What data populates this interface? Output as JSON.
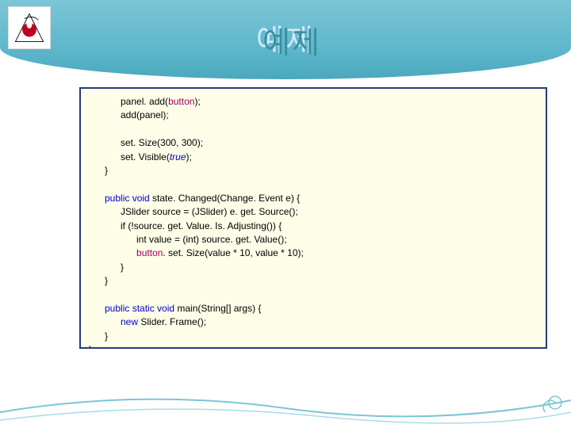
{
  "slide": {
    "title": "예제"
  },
  "code": {
    "l1": "            panel. add(",
    "l1b": "button",
    "l1c": ");",
    "l2": "            add(panel);",
    "l3": "",
    "l4": "            set. Size(300, 300);",
    "l5a": "            set. Visible(",
    "l5b": "true",
    "l5c": ");",
    "l6": "      }",
    "l7": "",
    "l8a": "      public void ",
    "l8b": "state. Changed(Change. Event e) {",
    "l9": "            JSlider source = (JSlider) e. get. Source();",
    "l10": "            if (!source. get. Value. Is. Adjusting()) {",
    "l11a": "                  int value = (int) source. get. Value();",
    "l12a": "                  ",
    "l12b": "button",
    "l12c": ". set. Size(value * 10, value * 10);",
    "l13": "            }",
    "l14": "      }",
    "l15": "",
    "l16a": "      public static void ",
    "l16b": "main(String[] args) {",
    "l17a": "            new ",
    "l17b": "Slider. Frame();",
    "l18": "      }",
    "l19": "}"
  }
}
